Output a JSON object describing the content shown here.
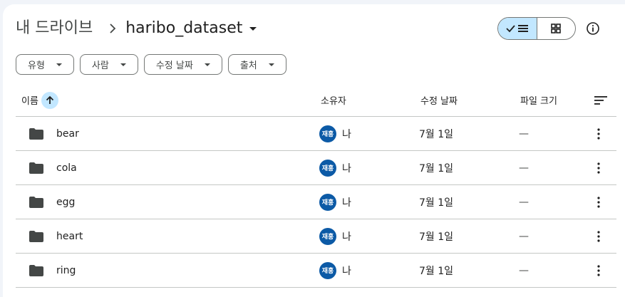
{
  "breadcrumb": {
    "root": "내 드라이브",
    "current": "haribo_dataset"
  },
  "filters": [
    {
      "label": "유형"
    },
    {
      "label": "사람"
    },
    {
      "label": "수정 날짜"
    },
    {
      "label": "출처"
    }
  ],
  "columns": {
    "name": "이름",
    "owner": "소유자",
    "modified": "수정 날짜",
    "size": "파일 크기"
  },
  "rows": [
    {
      "name": "bear",
      "owner_avatar": "재홍",
      "owner": "나",
      "modified": "7월 1일",
      "size": "—"
    },
    {
      "name": "cola",
      "owner_avatar": "재홍",
      "owner": "나",
      "modified": "7월 1일",
      "size": "—"
    },
    {
      "name": "egg",
      "owner_avatar": "재홍",
      "owner": "나",
      "modified": "7월 1일",
      "size": "—"
    },
    {
      "name": "heart",
      "owner_avatar": "재홍",
      "owner": "나",
      "modified": "7월 1일",
      "size": "—"
    },
    {
      "name": "ring",
      "owner_avatar": "재홍",
      "owner": "나",
      "modified": "7월 1일",
      "size": "—"
    }
  ],
  "icons": {
    "breadcrumb_separator": "chevron-right-icon",
    "list_view": "check-list-icon",
    "grid_view": "grid-icon",
    "info": "info-icon",
    "sort": "arrow-up-icon",
    "sort_options": "sort-lines-icon",
    "folder": "folder-icon",
    "more": "more-vert-icon"
  },
  "colors": {
    "accent": "#c2e7ff",
    "avatar": "#0c5aa6",
    "folder": "#444746"
  }
}
